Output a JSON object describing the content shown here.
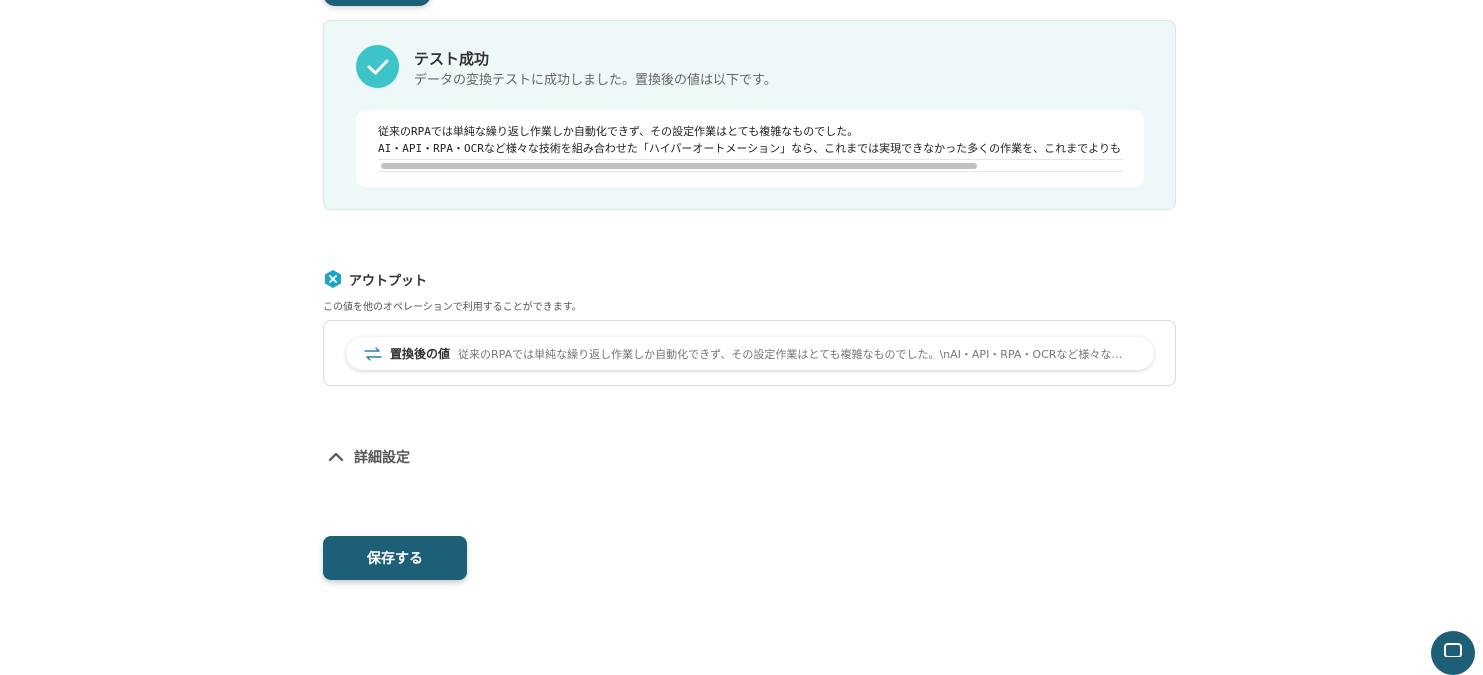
{
  "test_result": {
    "title": "テスト成功",
    "description": "データの変換テストに成功しました。置換後の値は以下です。",
    "lines": [
      "従来のRPAでは単純な繰り返し作業しか自動化できず、その設定作業はとても複雑なものでした。",
      "AI・API・RPA・OCRなど様々な技術を組み合わせた「ハイパーオートメーション」なら、これまでは実現できなかった多くの作業を、これまでよりも"
    ],
    "scroll_thumb_fraction": 0.8
  },
  "output": {
    "title": "アウトプット",
    "description": "この値を他のオペレーションで利用することができます。",
    "item_label": "置換後の値",
    "item_value": "従来のRPAでは単純な繰り返し作業しか自動化できず、その設定作業はとても複雑なものでした。\\nAI・API・RPA・OCRなど様々な技術を組み合わせた「ハイパーオートメーション」なら、これまでは実現できなかった多くの作業を、これまでよりも"
  },
  "advanced": {
    "label": "詳細設定"
  },
  "actions": {
    "save_label": "保存する"
  },
  "icons": {
    "success": "check-icon",
    "output": "variable-x-icon",
    "output_item": "swap-arrows-icon",
    "advanced": "chevron-up-icon",
    "chat": "chat-icon"
  },
  "colors": {
    "primary": "#1e5f78",
    "success": "#3cc4c9",
    "panel_bg": "#eef8f8"
  }
}
